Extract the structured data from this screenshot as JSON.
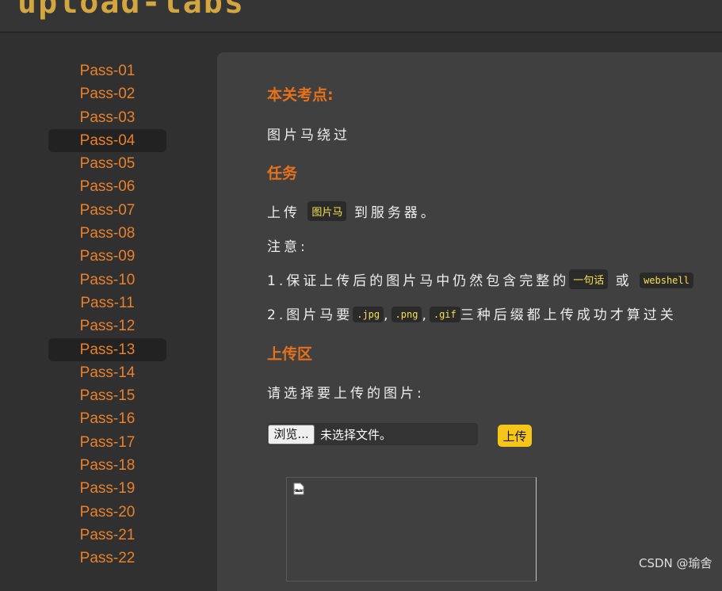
{
  "header": {
    "logo_text": "upload-labs"
  },
  "sidebar": {
    "items": [
      {
        "label": "Pass-01"
      },
      {
        "label": "Pass-02"
      },
      {
        "label": "Pass-03"
      },
      {
        "label": "Pass-04",
        "active": true
      },
      {
        "label": "Pass-05"
      },
      {
        "label": "Pass-06"
      },
      {
        "label": "Pass-07"
      },
      {
        "label": "Pass-08"
      },
      {
        "label": "Pass-09"
      },
      {
        "label": "Pass-10"
      },
      {
        "label": "Pass-11"
      },
      {
        "label": "Pass-12"
      },
      {
        "label": "Pass-13",
        "active": true
      },
      {
        "label": "Pass-14"
      },
      {
        "label": "Pass-15"
      },
      {
        "label": "Pass-16"
      },
      {
        "label": "Pass-17"
      },
      {
        "label": "Pass-18"
      },
      {
        "label": "Pass-19"
      },
      {
        "label": "Pass-20"
      },
      {
        "label": "Pass-21"
      },
      {
        "label": "Pass-22"
      }
    ]
  },
  "content": {
    "key_point_heading": "本关考点:",
    "key_point_text": "图片马绕过",
    "task_heading": "任务",
    "task_prefix": "上传",
    "task_code": "图片马",
    "task_suffix": "到服务器。",
    "notice_label": "注意:",
    "rule1_text": "1.保证上传后的图片马中仍然包含完整的",
    "rule1_code1": "一句话",
    "rule1_or": "或",
    "rule1_code2": "webshell",
    "rule2_text": "2.图片马要",
    "rule2_ext1": ".jpg",
    "rule2_ext2": ".png",
    "rule2_ext3": ".gif",
    "rule2_sep": ",",
    "rule2_suffix": "三种后缀都上传成功才算过关",
    "upload_heading": "上传区",
    "upload_prompt": "请选择要上传的图片:",
    "browse_label": "浏览...",
    "file_status": "未选择文件。",
    "upload_button": "上传"
  },
  "watermark": "CSDN @瑜舍",
  "colors": {
    "accent": "#e7711b",
    "menu_text": "#e8802c",
    "upload_button": "#f5c518",
    "code_text": "#f4e04d"
  }
}
